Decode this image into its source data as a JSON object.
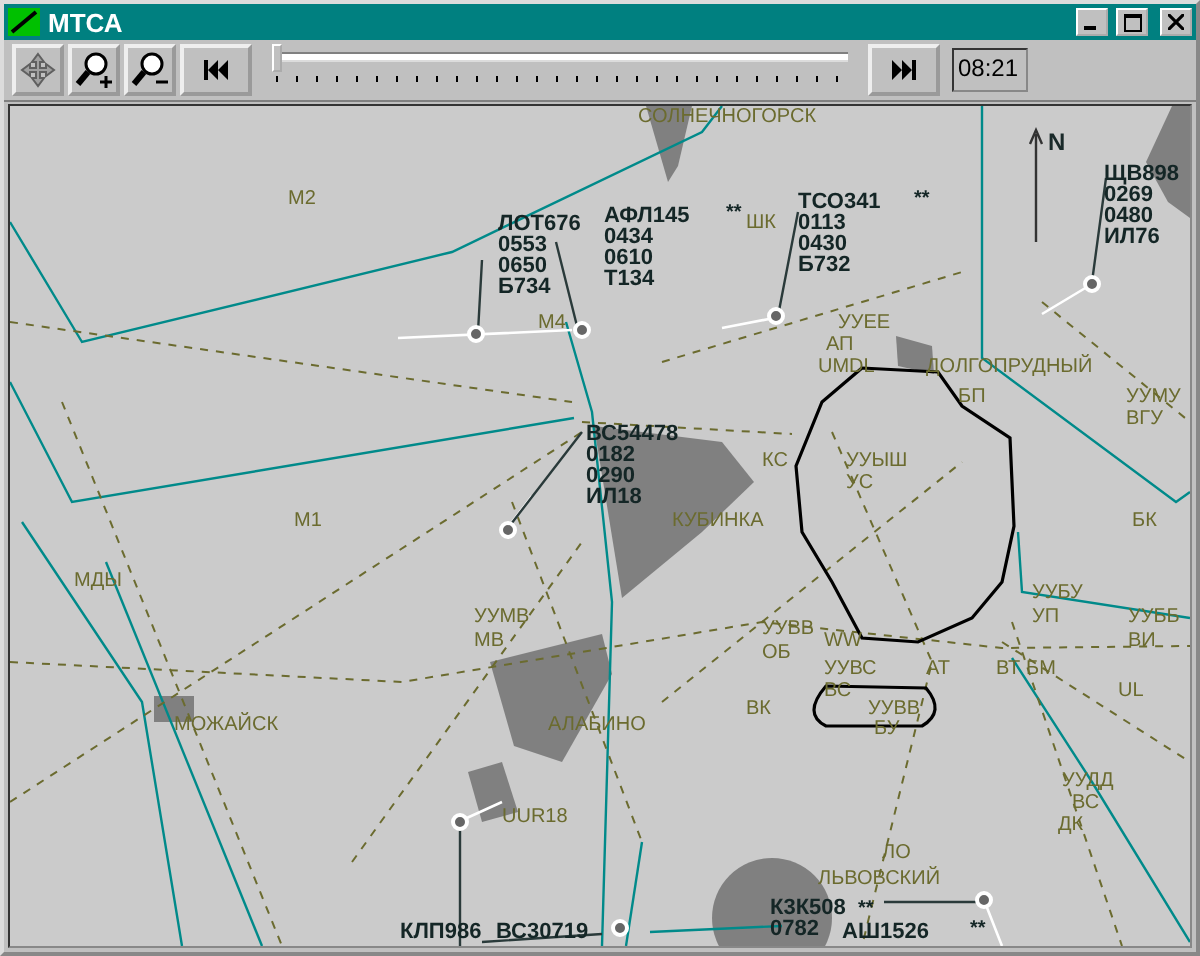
{
  "window": {
    "title": "МТСА"
  },
  "toolbar": {
    "buttons": [
      {
        "kind": "pan"
      },
      {
        "kind": "zoom_in"
      },
      {
        "kind": "zoom_out"
      },
      {
        "kind": "rewind"
      }
    ],
    "timeline": {
      "level": 0
    },
    "end_button": {
      "kind": "fast_forward"
    },
    "time": "08:21"
  },
  "map": {
    "north": "N",
    "labels": [
      "СОЛНЕЧНОГОРСК",
      "M2",
      "ШК",
      "M4",
      "УУЕЕ",
      "АП",
      "UMDL",
      "ДОЛГОПРУДНЫЙ",
      "БП",
      "УУМУ",
      "ВГУ",
      "КС",
      "УУЫШ",
      "УС",
      "M1",
      "КУБИНКА",
      "БК",
      "МДЫ",
      "УУБУ",
      "УУМВ",
      "УП",
      "УУББ",
      "УУВВ",
      "МВ",
      "WW",
      "ВИ",
      "ОБ",
      "УУВС",
      "АТ",
      "ВТ",
      "БМ",
      "ВС",
      "UL",
      "ВК",
      "УУВВ",
      "МОЖАЙСК",
      "АЛАБИНО",
      "БУ",
      "УУДД",
      "ВС",
      "UUR18",
      "ДК",
      "ЛО",
      "ЛЬВОВСКИЙ"
    ],
    "flights": [
      {
        "lines": [
          "ЛОТ676",
          "0553",
          "0650",
          "Б734"
        ]
      },
      {
        "lines": [
          "АФЛ145",
          "0434",
          "0610",
          "Т134"
        ],
        "marker": "**"
      },
      {
        "lines": [
          "ТСО341",
          "0113",
          "0430",
          "Б732"
        ],
        "marker": "**"
      },
      {
        "lines": [
          "ЩВ898",
          "0269",
          "0480",
          "ИЛ76"
        ]
      },
      {
        "lines": [
          "ВС54478",
          "0182",
          "0290",
          "ИЛ18"
        ]
      },
      {
        "lines": [
          "КЛП986"
        ]
      },
      {
        "lines": [
          "ВС30719"
        ]
      },
      {
        "lines": [
          "К3К508",
          "0782"
        ],
        "marker": "**"
      },
      {
        "lines": [
          "АШ1526"
        ],
        "marker": "**"
      }
    ]
  }
}
